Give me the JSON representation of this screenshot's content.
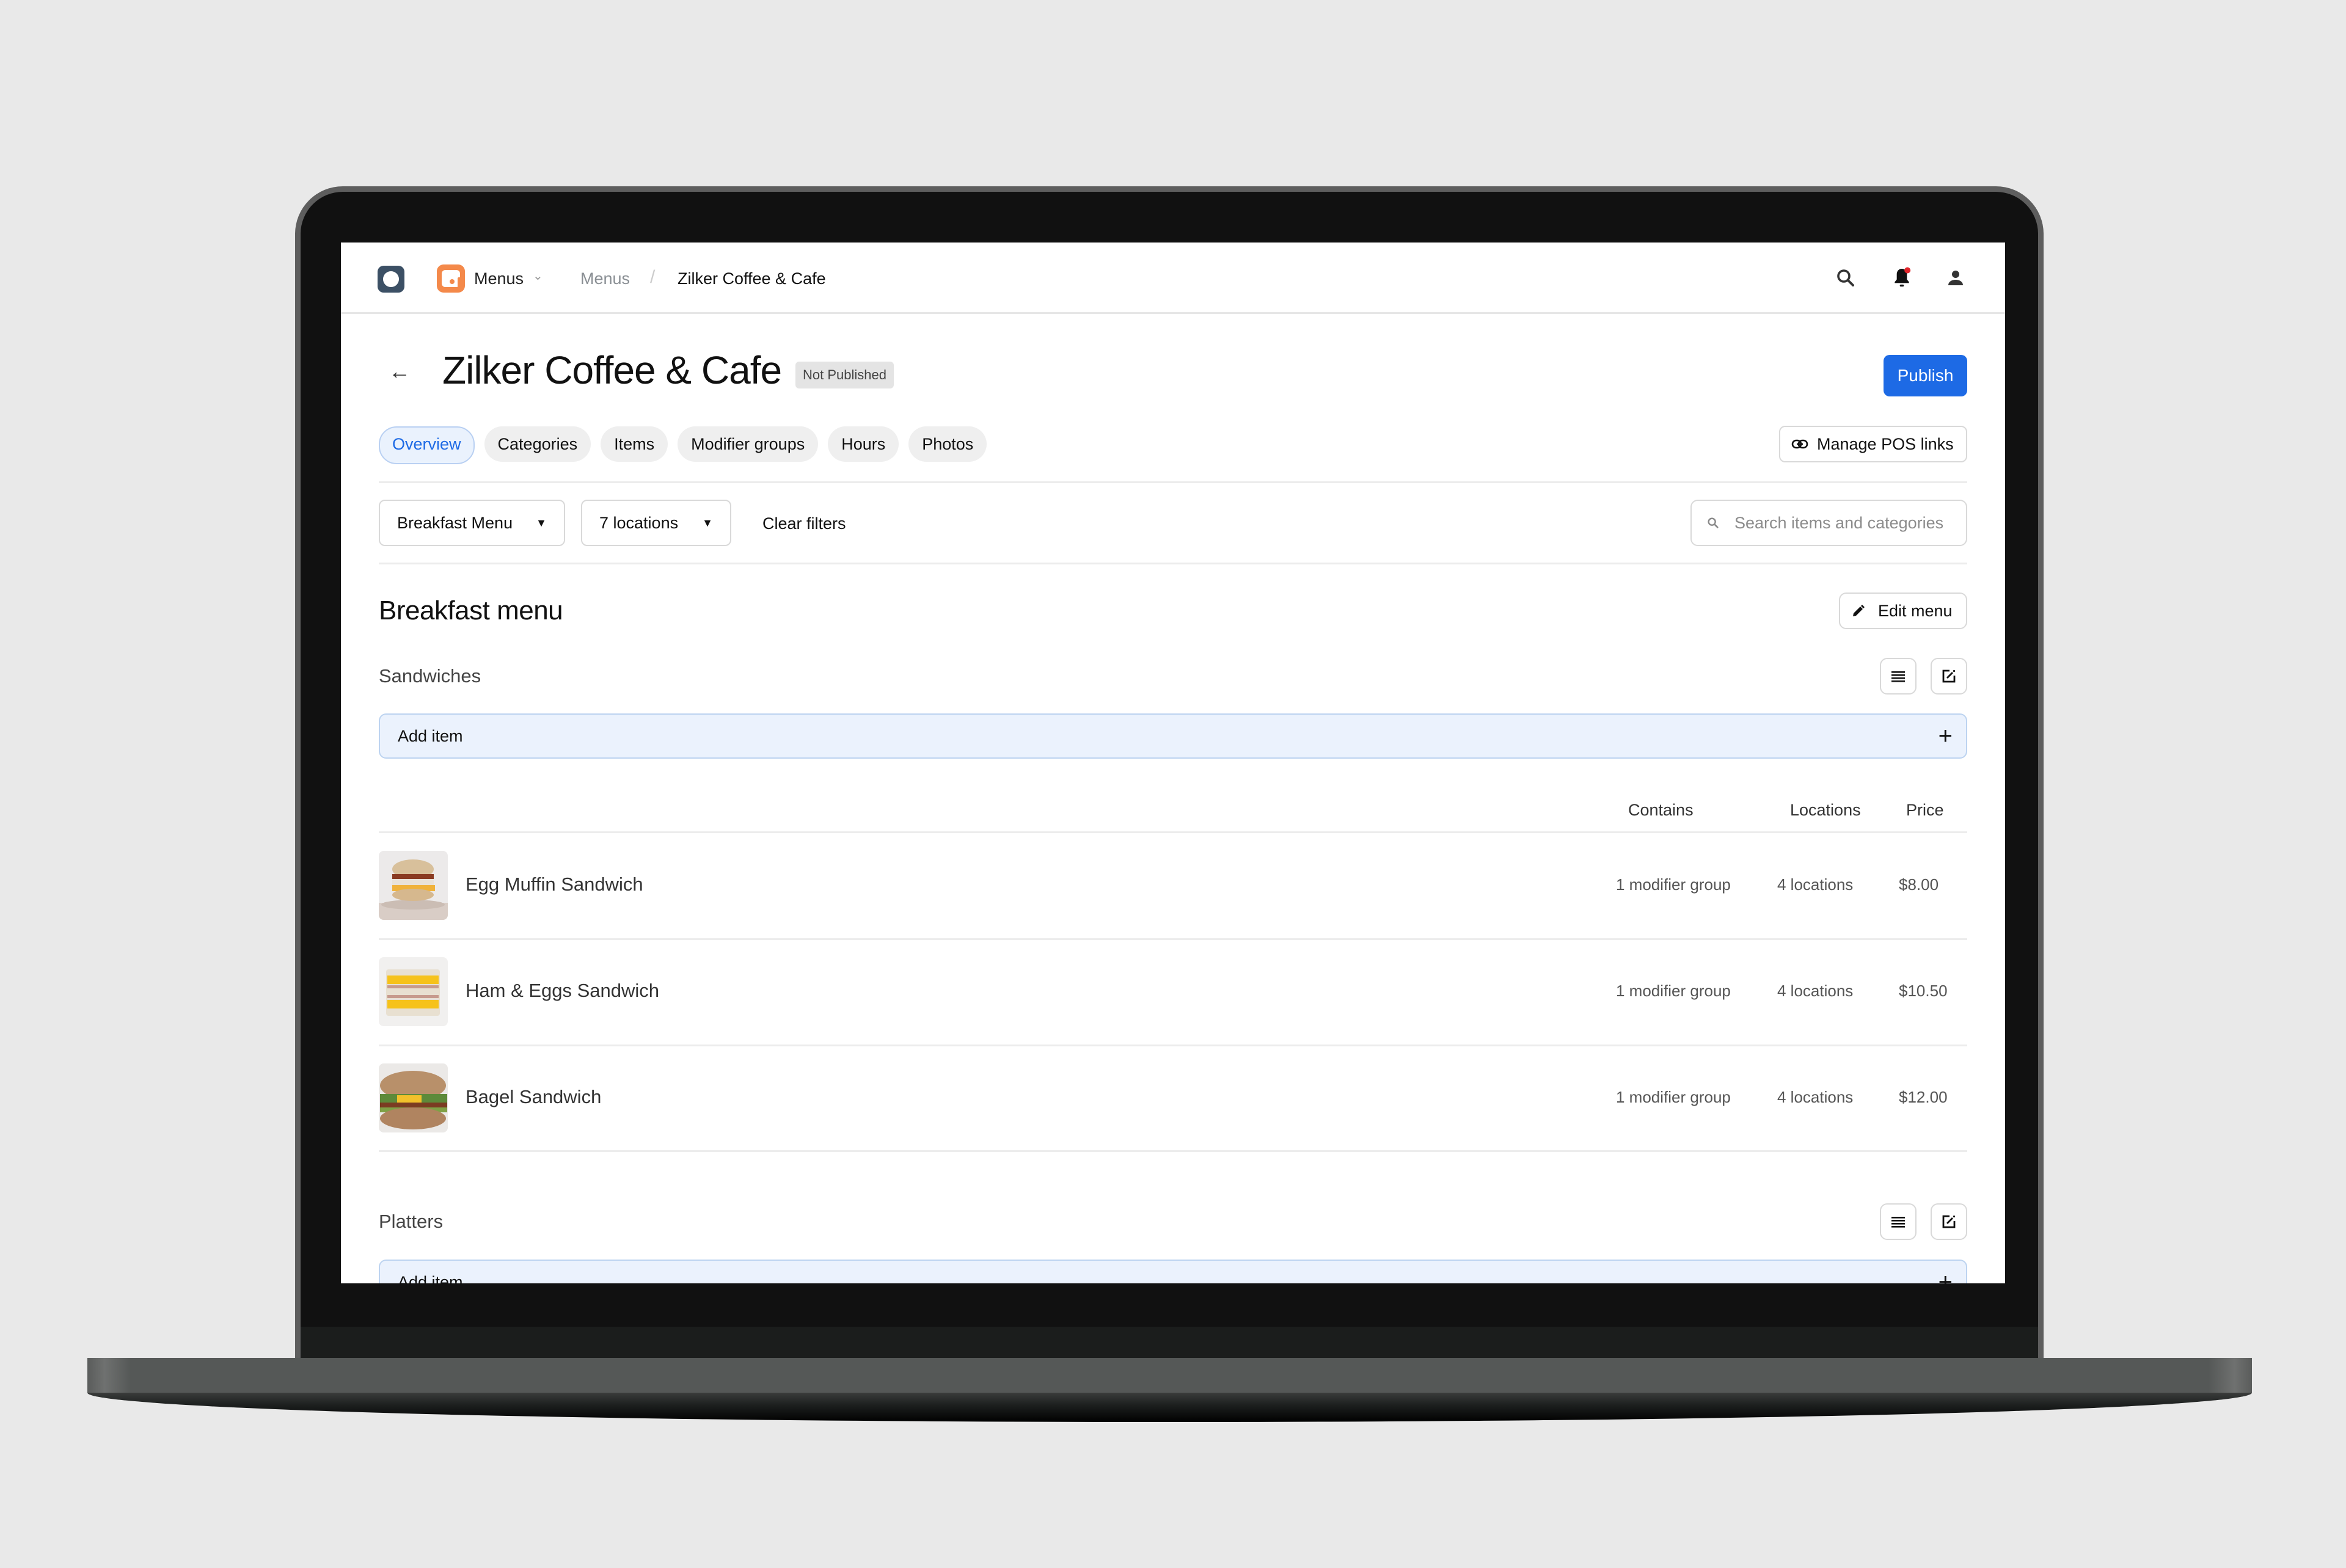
{
  "topbar": {
    "app_name": "Menus",
    "breadcrumb": [
      "Menus",
      "Zilker Coffee & Cafe"
    ],
    "breadcrumb_separator": "/",
    "icons": [
      "search-icon",
      "bell-icon",
      "user-icon"
    ],
    "notification_dot_color": "#e0242a"
  },
  "header": {
    "title": "Zilker Coffee & Cafe",
    "status_badge": "Not Published",
    "publish_label": "Publish",
    "accent_color": "#1d6ae5"
  },
  "tabs": [
    {
      "label": "Overview",
      "active": true
    },
    {
      "label": "Categories",
      "active": false
    },
    {
      "label": "Items",
      "active": false
    },
    {
      "label": "Modifier groups",
      "active": false
    },
    {
      "label": "Hours",
      "active": false
    },
    {
      "label": "Photos",
      "active": false
    }
  ],
  "manage_pos_label": "Manage POS links",
  "filters": {
    "menu_select": "Breakfast Menu",
    "locations_select": "7 locations",
    "clear_label": "Clear filters",
    "search_placeholder": "Search items and categories"
  },
  "menu": {
    "title": "Breakfast menu",
    "edit_label": "Edit menu",
    "add_item_label": "Add item",
    "columns": [
      "Contains",
      "Locations",
      "Price"
    ],
    "categories": [
      {
        "name": "Sandwiches",
        "items": [
          {
            "name": "Egg Muffin Sandwich",
            "contains": "1 modifier group",
            "locations": "4 locations",
            "price": "$8.00"
          },
          {
            "name": "Ham & Eggs Sandwich",
            "contains": "1 modifier group",
            "locations": "4 locations",
            "price": "$10.50"
          },
          {
            "name": "Bagel Sandwich",
            "contains": "1 modifier group",
            "locations": "4 locations",
            "price": "$12.00"
          }
        ]
      },
      {
        "name": "Platters",
        "items": []
      }
    ]
  }
}
